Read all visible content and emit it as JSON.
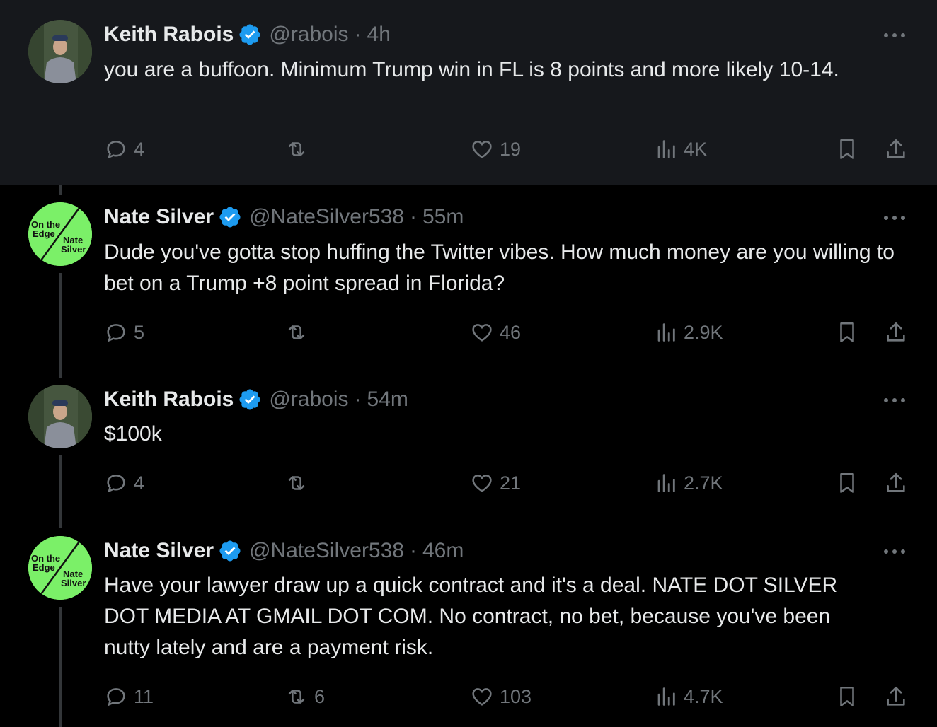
{
  "tweets": [
    {
      "name": "Keith Rabois",
      "handle": "@rabois",
      "time": "4h",
      "text": "you are a buffoon.  Minimum Trump win in FL is 8 points and more likely 10-14.",
      "avatar": "keith-avatar",
      "counts": {
        "replies": "4",
        "retweets": "",
        "likes": "19",
        "views": "4K"
      }
    },
    {
      "name": "Nate Silver",
      "handle": "@NateSilver538",
      "time": "55m",
      "text": "Dude you've gotta stop huffing the Twitter vibes. How much money are you willing to bet on a Trump +8 point spread in Florida?",
      "avatar": "nate-avatar",
      "counts": {
        "replies": "5",
        "retweets": "",
        "likes": "46",
        "views": "2.9K"
      }
    },
    {
      "name": "Keith Rabois",
      "handle": "@rabois",
      "time": "54m",
      "text": "$100k",
      "avatar": "keith-avatar",
      "counts": {
        "replies": "4",
        "retweets": "",
        "likes": "21",
        "views": "2.7K"
      }
    },
    {
      "name": "Nate Silver",
      "handle": "@NateSilver538",
      "time": "46m",
      "text": "Have your lawyer draw up a quick contract and it's a deal. NATE DOT SILVER DOT MEDIA AT GMAIL DOT COM. No contract, no bet, because you've been nutty lately and are a payment risk.",
      "avatar": "nate-avatar",
      "counts": {
        "replies": "11",
        "retweets": "6",
        "likes": "103",
        "views": "4.7K"
      }
    }
  ],
  "book_avatar": {
    "line1": "On the",
    "line2": "Edge",
    "line3": "Nate",
    "line4": "Silver"
  },
  "separator": "·",
  "colors": {
    "background": "#000000",
    "highlight": "#16181c",
    "verified": "#1d9bf0",
    "muted": "#71767b",
    "text": "#e7e9ea",
    "book_green": "#7bf068"
  }
}
